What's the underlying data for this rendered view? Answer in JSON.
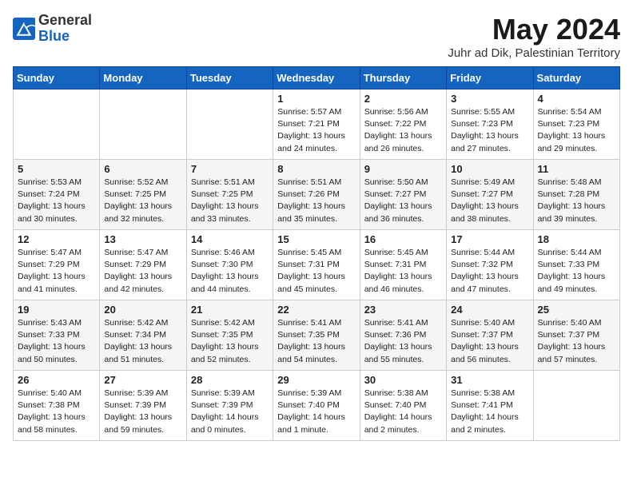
{
  "header": {
    "logo_general": "General",
    "logo_blue": "Blue",
    "month_year": "May 2024",
    "location": "Juhr ad Dik, Palestinian Territory"
  },
  "weekdays": [
    "Sunday",
    "Monday",
    "Tuesday",
    "Wednesday",
    "Thursday",
    "Friday",
    "Saturday"
  ],
  "weeks": [
    [
      {
        "day": "",
        "info": ""
      },
      {
        "day": "",
        "info": ""
      },
      {
        "day": "",
        "info": ""
      },
      {
        "day": "1",
        "info": "Sunrise: 5:57 AM\nSunset: 7:21 PM\nDaylight: 13 hours\nand 24 minutes."
      },
      {
        "day": "2",
        "info": "Sunrise: 5:56 AM\nSunset: 7:22 PM\nDaylight: 13 hours\nand 26 minutes."
      },
      {
        "day": "3",
        "info": "Sunrise: 5:55 AM\nSunset: 7:23 PM\nDaylight: 13 hours\nand 27 minutes."
      },
      {
        "day": "4",
        "info": "Sunrise: 5:54 AM\nSunset: 7:23 PM\nDaylight: 13 hours\nand 29 minutes."
      }
    ],
    [
      {
        "day": "5",
        "info": "Sunrise: 5:53 AM\nSunset: 7:24 PM\nDaylight: 13 hours\nand 30 minutes."
      },
      {
        "day": "6",
        "info": "Sunrise: 5:52 AM\nSunset: 7:25 PM\nDaylight: 13 hours\nand 32 minutes."
      },
      {
        "day": "7",
        "info": "Sunrise: 5:51 AM\nSunset: 7:25 PM\nDaylight: 13 hours\nand 33 minutes."
      },
      {
        "day": "8",
        "info": "Sunrise: 5:51 AM\nSunset: 7:26 PM\nDaylight: 13 hours\nand 35 minutes."
      },
      {
        "day": "9",
        "info": "Sunrise: 5:50 AM\nSunset: 7:27 PM\nDaylight: 13 hours\nand 36 minutes."
      },
      {
        "day": "10",
        "info": "Sunrise: 5:49 AM\nSunset: 7:27 PM\nDaylight: 13 hours\nand 38 minutes."
      },
      {
        "day": "11",
        "info": "Sunrise: 5:48 AM\nSunset: 7:28 PM\nDaylight: 13 hours\nand 39 minutes."
      }
    ],
    [
      {
        "day": "12",
        "info": "Sunrise: 5:47 AM\nSunset: 7:29 PM\nDaylight: 13 hours\nand 41 minutes."
      },
      {
        "day": "13",
        "info": "Sunrise: 5:47 AM\nSunset: 7:29 PM\nDaylight: 13 hours\nand 42 minutes."
      },
      {
        "day": "14",
        "info": "Sunrise: 5:46 AM\nSunset: 7:30 PM\nDaylight: 13 hours\nand 44 minutes."
      },
      {
        "day": "15",
        "info": "Sunrise: 5:45 AM\nSunset: 7:31 PM\nDaylight: 13 hours\nand 45 minutes."
      },
      {
        "day": "16",
        "info": "Sunrise: 5:45 AM\nSunset: 7:31 PM\nDaylight: 13 hours\nand 46 minutes."
      },
      {
        "day": "17",
        "info": "Sunrise: 5:44 AM\nSunset: 7:32 PM\nDaylight: 13 hours\nand 47 minutes."
      },
      {
        "day": "18",
        "info": "Sunrise: 5:44 AM\nSunset: 7:33 PM\nDaylight: 13 hours\nand 49 minutes."
      }
    ],
    [
      {
        "day": "19",
        "info": "Sunrise: 5:43 AM\nSunset: 7:33 PM\nDaylight: 13 hours\nand 50 minutes."
      },
      {
        "day": "20",
        "info": "Sunrise: 5:42 AM\nSunset: 7:34 PM\nDaylight: 13 hours\nand 51 minutes."
      },
      {
        "day": "21",
        "info": "Sunrise: 5:42 AM\nSunset: 7:35 PM\nDaylight: 13 hours\nand 52 minutes."
      },
      {
        "day": "22",
        "info": "Sunrise: 5:41 AM\nSunset: 7:35 PM\nDaylight: 13 hours\nand 54 minutes."
      },
      {
        "day": "23",
        "info": "Sunrise: 5:41 AM\nSunset: 7:36 PM\nDaylight: 13 hours\nand 55 minutes."
      },
      {
        "day": "24",
        "info": "Sunrise: 5:40 AM\nSunset: 7:37 PM\nDaylight: 13 hours\nand 56 minutes."
      },
      {
        "day": "25",
        "info": "Sunrise: 5:40 AM\nSunset: 7:37 PM\nDaylight: 13 hours\nand 57 minutes."
      }
    ],
    [
      {
        "day": "26",
        "info": "Sunrise: 5:40 AM\nSunset: 7:38 PM\nDaylight: 13 hours\nand 58 minutes."
      },
      {
        "day": "27",
        "info": "Sunrise: 5:39 AM\nSunset: 7:39 PM\nDaylight: 13 hours\nand 59 minutes."
      },
      {
        "day": "28",
        "info": "Sunrise: 5:39 AM\nSunset: 7:39 PM\nDaylight: 14 hours\nand 0 minutes."
      },
      {
        "day": "29",
        "info": "Sunrise: 5:39 AM\nSunset: 7:40 PM\nDaylight: 14 hours\nand 1 minute."
      },
      {
        "day": "30",
        "info": "Sunrise: 5:38 AM\nSunset: 7:40 PM\nDaylight: 14 hours\nand 2 minutes."
      },
      {
        "day": "31",
        "info": "Sunrise: 5:38 AM\nSunset: 7:41 PM\nDaylight: 14 hours\nand 2 minutes."
      },
      {
        "day": "",
        "info": ""
      }
    ]
  ]
}
